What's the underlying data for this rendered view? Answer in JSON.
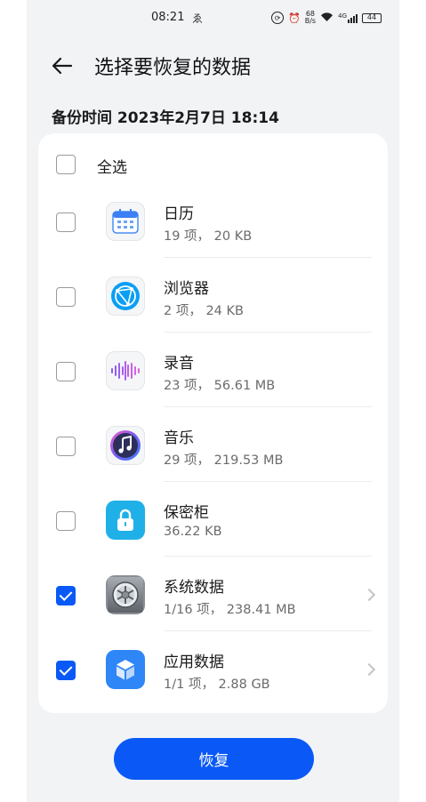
{
  "status_bar": {
    "time": "08:21",
    "extra": "ゑ",
    "net_speed_value": "68",
    "net_speed_unit": "B/s",
    "signal_type": "4G",
    "battery": "44"
  },
  "header": {
    "title": "选择要恢复的数据"
  },
  "backup_time": "备份时间 2023年2月7日 18:14",
  "select_all": {
    "label": "全选",
    "checked": false
  },
  "items": [
    {
      "name": "日历",
      "meta": "19 项， 20 KB",
      "icon": "calendar-icon",
      "checked": false,
      "has_chevron": false
    },
    {
      "name": "浏览器",
      "meta": "2 项， 24 KB",
      "icon": "browser-icon",
      "checked": false,
      "has_chevron": false
    },
    {
      "name": "录音",
      "meta": "23 项， 56.61 MB",
      "icon": "recorder-icon",
      "checked": false,
      "has_chevron": false
    },
    {
      "name": "音乐",
      "meta": "29 项， 219.53 MB",
      "icon": "music-icon",
      "checked": false,
      "has_chevron": false
    },
    {
      "name": "保密柜",
      "meta": "36.22 KB",
      "icon": "lock-icon",
      "checked": false,
      "has_chevron": false
    },
    {
      "name": "系统数据",
      "meta": "1/16 项， 238.41 MB",
      "icon": "system-settings-icon",
      "checked": true,
      "has_chevron": true
    },
    {
      "name": "应用数据",
      "meta": "1/1 项， 2.88 GB",
      "icon": "app-data-icon",
      "checked": true,
      "has_chevron": true
    }
  ],
  "restore_button": "恢复",
  "colors": {
    "accent": "#0a59f7",
    "background": "#f1f3f5",
    "card": "#ffffff"
  }
}
